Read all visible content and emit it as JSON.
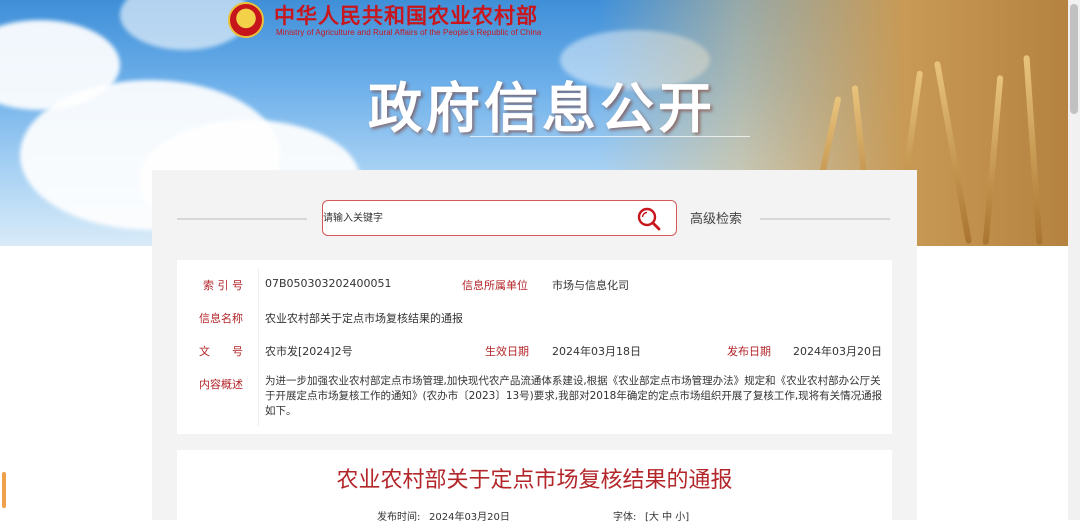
{
  "header": {
    "ministry_cn": "中华人民共和国农业农村部",
    "ministry_en": "Ministry of Agriculture and Rural Affairs of the People's Republic of China",
    "banner_title": "政府信息公开"
  },
  "search": {
    "placeholder": "请输入关键字",
    "button_icon": "search-icon",
    "advanced_label": "高级检索"
  },
  "info": {
    "index_label": "索 引 号",
    "index_value": "07B050303202400051",
    "org_label": "信息所属单位",
    "org_value": "市场与信息化司",
    "name_label": "信息名称",
    "name_value": "农业农村部关于定点市场复核结果的通报",
    "doc_label": "文　　号",
    "doc_value": "农市发[2024]2号",
    "effective_label": "生效日期",
    "effective_value": "2024年03月18日",
    "publish_label": "发布日期",
    "publish_value": "2024年03月20日",
    "summary_label": "内容概述",
    "summary_value": "为进一步加强农业农村部定点市场管理,加快现代农产品流通体系建设,根据《农业部定点市场管理办法》规定和《农业农村部办公厅关于开展定点市场复核工作的通知》(农办市〔2023〕13号)要求,我部对2018年确定的定点市场组织开展了复核工作,现将有关情况通报如下。"
  },
  "article": {
    "title": "农业农村部关于定点市场复核结果的通报",
    "publish_time_label": "发布时间:",
    "publish_time_value": "2024年03月20日",
    "font_label": "字体:",
    "font_options": "[大 中 小]"
  },
  "colors": {
    "accent_red": "#b3262a",
    "search_border": "#d35a5a"
  }
}
